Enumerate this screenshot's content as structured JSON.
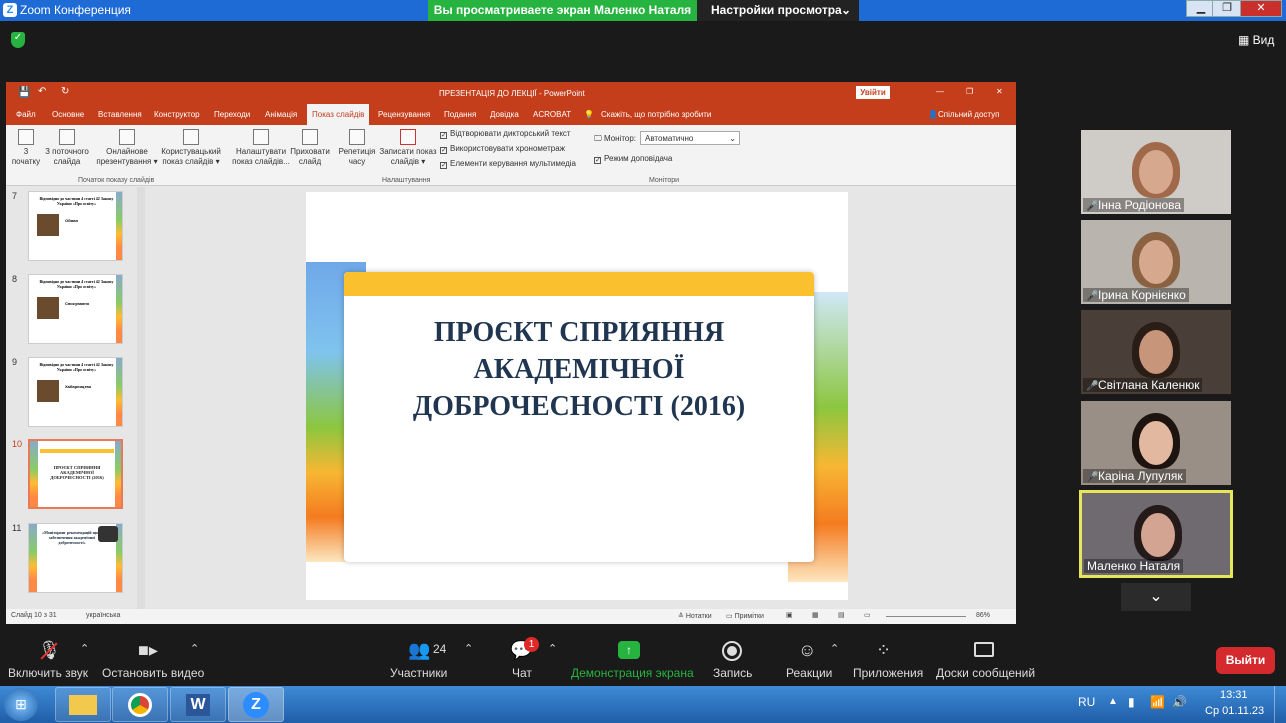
{
  "zoom": {
    "title": "Zoom Конференция",
    "viewing_banner": "Вы просматриваете экран Маленко Наталя",
    "view_settings": "Настройки просмотра",
    "view_label": "Вид"
  },
  "ppt": {
    "title": "ПРЕЗЕНТАЦІЯ ДО ЛЕКЦІЇ  -  PowerPoint",
    "signin": "Увійти",
    "share": "Спільний доступ",
    "tabs": [
      "Файл",
      "Основне",
      "Вставлення",
      "Конструктор",
      "Переходи",
      "Анімація",
      "Показ слайдів",
      "Рецензування",
      "Подання",
      "Довідка",
      "ACROBAT"
    ],
    "tell_me": "Скажіть, що потрібно зробити",
    "ribbon": {
      "from_start": "3\nпочатку",
      "from_current": "З поточного\nслайда",
      "online": "Онлайнове\nпрезентування ▾",
      "custom": "Користувацький\nпоказ слайдів ▾",
      "group1": "Початок показу слайдів",
      "setup": "Налаштувати\nпоказ слайдів...",
      "hide": "Приховати\nслайд",
      "rehearse": "Репетиція\nчасу",
      "record": "Записати показ\nслайдів ▾",
      "chk1": "Відтворювати дикторський текст",
      "chk2": "Використовувати хронометраж",
      "chk3": "Елементи керування мультимедіа",
      "group2": "Налаштування",
      "monitor_label": "Монітор:",
      "monitor_value": "Автоматично",
      "presenter": "Режим доповідача",
      "group3": "Монітори"
    },
    "thumbs": [
      {
        "num": "7",
        "title": "Відповідно до частини 4 статті 42 Закону України «Про освіту»",
        "body": "Обман"
      },
      {
        "num": "8",
        "title": "Відповідно до частини 4 статті 42 Закону України «Про освіту»",
        "body": "Списування"
      },
      {
        "num": "9",
        "title": "Відповідно до частини 4 статті 42 Закону України «Про освіту»",
        "body": "Хабарництво"
      },
      {
        "num": "10",
        "title": "ПРОЄКТ СПРИЯННЯ АКАДЕМІЧНОЇ ДОБРОЧЕСНОСТІ (2016)"
      },
      {
        "num": "11",
        "title": "«Моніторинг рекомендацій щодо забезпечення академічної доброчесності»"
      }
    ],
    "slide_title_lines": [
      "ПРОЄКТ СПРИЯННЯ",
      "АКАДЕМІЧНОЇ",
      "ДОБРОЧЕСНОСТІ (2016)"
    ],
    "status": {
      "slide": "Слайд 10 з 31",
      "lang": "українська",
      "notes": "Нотатки",
      "comments": "Примітки",
      "zoom": "86%"
    }
  },
  "participants": [
    {
      "name": "Інна Родіонова",
      "muted": true
    },
    {
      "name": "Ірина Корнієнко",
      "muted": true
    },
    {
      "name": "Світлана Каленюк",
      "muted": true
    },
    {
      "name": "Каріна Лупуляк",
      "muted": true
    },
    {
      "name": "Маленко Наталя",
      "muted": false
    }
  ],
  "toolbar": {
    "unmute": "Включить звук",
    "video": "Остановить видео",
    "participants": "Участники",
    "participants_count": "24",
    "chat": "Чат",
    "chat_badge": "1",
    "share": "Демонстрация экрана",
    "record": "Запись",
    "reactions": "Реакции",
    "apps": "Приложения",
    "whiteboard": "Доски сообщений",
    "exit": "Выйти"
  },
  "taskbar": {
    "lang": "RU",
    "time": "13:31",
    "date": "Ср 01.11.23"
  }
}
